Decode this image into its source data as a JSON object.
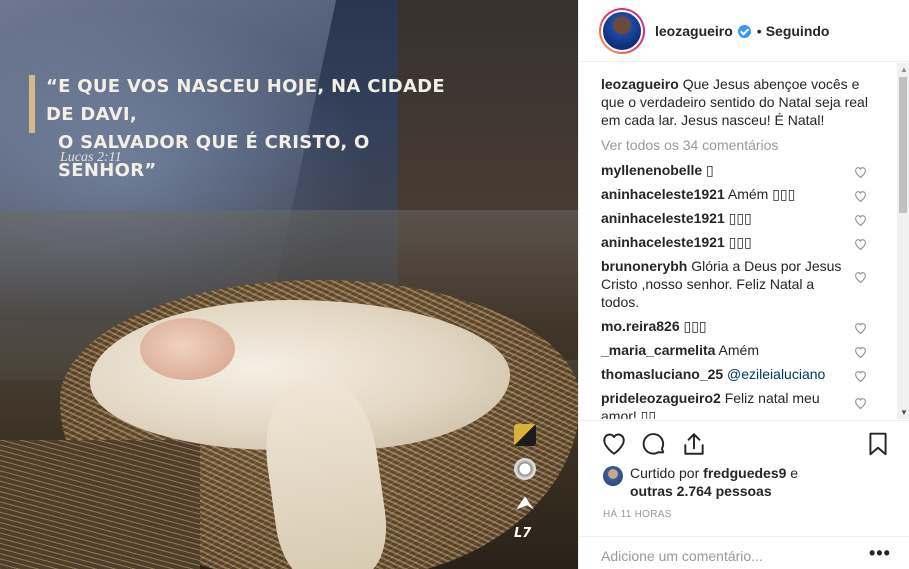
{
  "post_image": {
    "quote": "“E QUE VOS NASCEU HOJE, NA CIDADE DE DAVI,",
    "quote_line2": "O SALVADOR QUE É CRISTO, O SENHOR”",
    "reference": "Lucas 2:11",
    "logo4": "L7"
  },
  "header": {
    "username": "leozagueiro",
    "separator": "•",
    "follow_status": "Seguindo"
  },
  "caption": {
    "username": "leozagueiro",
    "text": "Que Jesus abençoe vocês e que o verdadeiro sentido do Natal seja real em cada lar. Jesus nasceu! É Natal!"
  },
  "view_all": "Ver todos os 34 comentários",
  "comments": [
    {
      "user": "myllenenobelle",
      "text": "▯"
    },
    {
      "user": "aninhaceleste1921",
      "text": "Amém ▯▯▯"
    },
    {
      "user": "aninhaceleste1921",
      "text": "▯▯▯"
    },
    {
      "user": "aninhaceleste1921",
      "text": "▯▯▯"
    },
    {
      "user": "brunonerybh",
      "text": "Glória a Deus por Jesus Cristo ,nosso senhor. Feliz Natal a todos."
    },
    {
      "user": "mo.reira826",
      "text": "▯▯▯"
    },
    {
      "user": "_maria_carmelita",
      "text": "Amém"
    },
    {
      "user": "thomasluciano_25",
      "mention": "@ezileialuciano"
    },
    {
      "user": "prideleozagueiro2",
      "text": "Feliz natal meu amor! ▯▯"
    }
  ],
  "likes": {
    "prefix": "Curtido por",
    "user": "fredguedes9",
    "connector": "e",
    "others": "outras 2.764 pessoas"
  },
  "time_ago": "HÁ 11 HORAS",
  "add_comment": {
    "placeholder": "Adicione um comentário...",
    "more": "•••"
  },
  "icons": {
    "like": "heart-icon",
    "comment": "comment-icon",
    "share": "share-icon",
    "save": "bookmark-icon"
  }
}
